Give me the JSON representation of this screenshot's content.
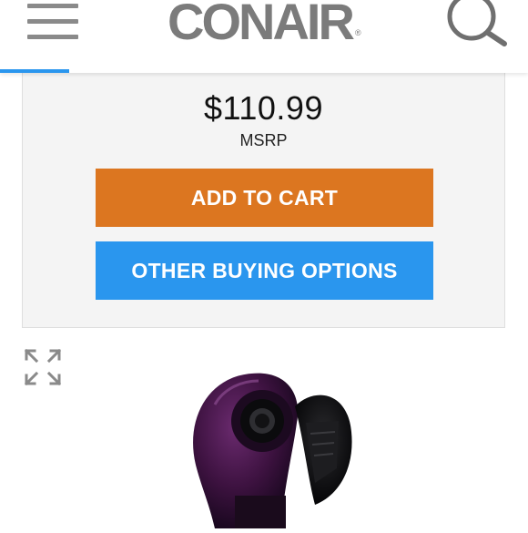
{
  "header": {
    "menu_icon": "hamburger-menu-icon",
    "logo_text": "CONAIR",
    "logo_mark": "®",
    "search_icon": "search-icon",
    "accent_color": "#2a96ee"
  },
  "product": {
    "price": "$110.99",
    "price_label": "MSRP"
  },
  "actions": {
    "add_to_cart": "ADD TO CART",
    "add_to_cart_color": "#dc7620",
    "other_buying_options": "OTHER BUYING OPTIONS",
    "other_buying_options_color": "#2a96ee"
  },
  "gallery": {
    "expand_icon": "expand-fullscreen-icon",
    "image": "purple-curling-device"
  }
}
